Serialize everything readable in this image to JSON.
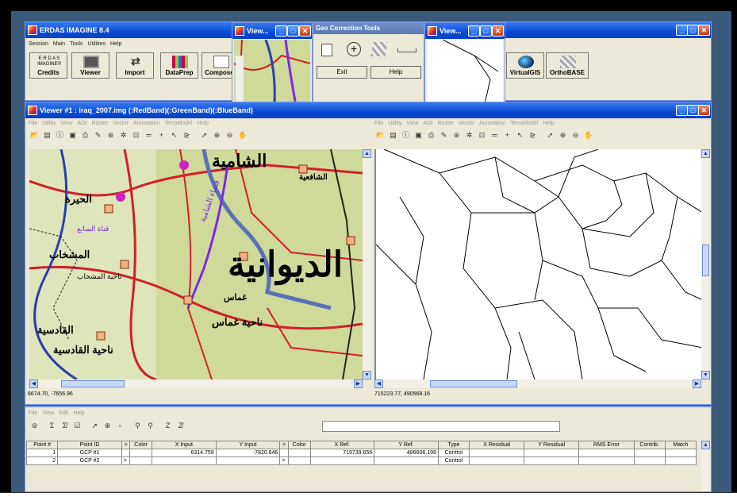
{
  "main_window": {
    "title": "ERDAS IMAGINE 8.4",
    "menu": [
      "Session",
      "Main",
      "Tools",
      "Utilities",
      "Help"
    ],
    "tools": [
      {
        "label": "Credits",
        "icon": "erdas-logo-icon",
        "logo_text": "E R D A S IMAGINE®"
      },
      {
        "label": "Viewer",
        "icon": "viewer-icon"
      },
      {
        "label": "Import",
        "icon": "import-arrows-icon"
      },
      {
        "label": "DataPrep",
        "icon": "dataprep-grid-icon"
      },
      {
        "label": "Composer",
        "icon": "composer-icon"
      },
      {
        "label": "VirtualGIS",
        "icon": "globe-icon"
      },
      {
        "label": "OrthoBASE",
        "icon": "orthobase-icon"
      }
    ]
  },
  "small_view_left": {
    "title": "View..."
  },
  "small_view_right": {
    "title": "View..."
  },
  "geo_tools": {
    "title": "Geo Correction Tools",
    "exit_label": "Exit",
    "help_label": "Help"
  },
  "viewer": {
    "title": "Viewer #1 : iraq_2007.img (:RedBand)(:GreenBand)(:BlueBand)",
    "menu": [
      "File",
      "Utility",
      "View",
      "AOI",
      "Raster",
      "Vector",
      "Annotation",
      "TerraModel",
      "Help"
    ],
    "left_status": "6674.70, -7656.96",
    "right_status": "715223.77, 490568.16"
  },
  "gcp_editor": {
    "menu": [
      "File",
      "View",
      "Edit",
      "Help"
    ],
    "columns": [
      "Point #",
      "Point ID",
      ">",
      "Color",
      "X Input",
      "Y Input",
      ">",
      "Color",
      "X Ref.",
      "Y Ref.",
      "Type",
      "X Residual",
      "Y Residual",
      "RMS Error",
      "Contrib.",
      "Match"
    ],
    "rows": [
      {
        "num": "1",
        "id": "GCP #1",
        "arrow1": "",
        "x_in": "6314.759",
        "y_in": "-7820.646",
        "arrow2": "",
        "x_ref": "719739.656",
        "y_ref": "486606.199",
        "type": "Control"
      },
      {
        "num": "2",
        "id": "GCP #2",
        "arrow1": ">",
        "x_in": "",
        "y_in": "",
        "arrow2": ">",
        "x_ref": "",
        "y_ref": "",
        "type": "Control"
      }
    ]
  },
  "map_labels": [
    {
      "text": "الشامية",
      "size": "large"
    },
    {
      "text": "الحيرة",
      "size": "medium"
    },
    {
      "text": "المشخاب",
      "size": "medium"
    },
    {
      "text": "ناحية المشخاب",
      "size": "small"
    },
    {
      "text": "الشافعية",
      "size": "small"
    },
    {
      "text": "قضاء الشامية",
      "size": "small"
    },
    {
      "text": "قناة السابع",
      "size": "small"
    },
    {
      "text": "الديوانية",
      "size": "huge"
    },
    {
      "text": "غماس",
      "size": "medium"
    },
    {
      "text": "ناحية غماس",
      "size": "medium"
    },
    {
      "text": "القادسية",
      "size": "medium"
    },
    {
      "text": "ناحية القادسية",
      "size": "medium"
    }
  ],
  "colors": {
    "titlebar": "#0a4bd4",
    "map_bg": "#cfd99a",
    "road": "#d0202a",
    "river": "#2b3fae",
    "canal": "#7a2be0",
    "chrome": "#ece9d8"
  }
}
